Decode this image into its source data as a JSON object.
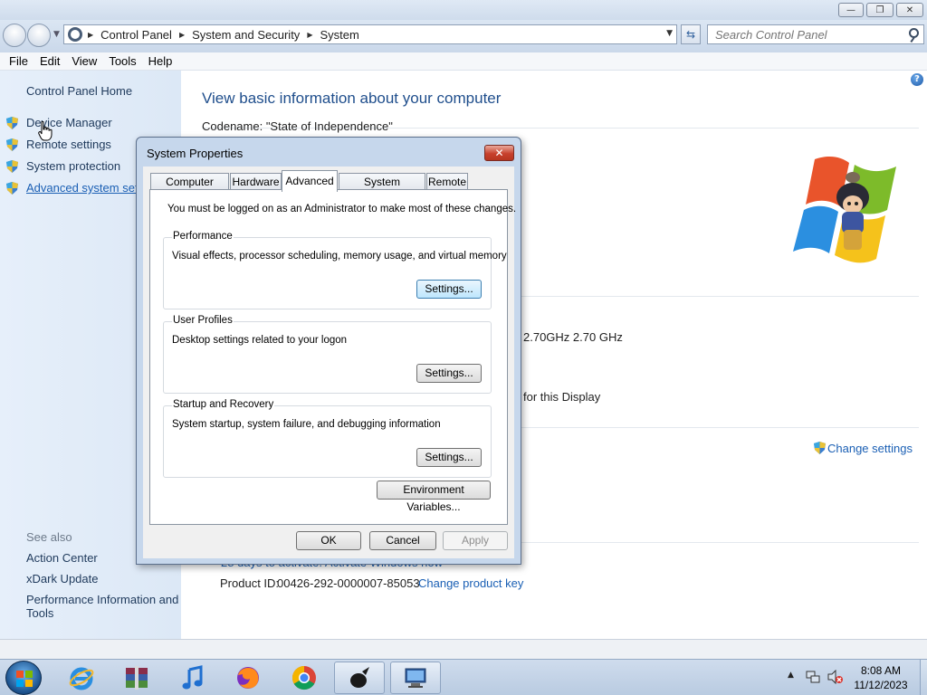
{
  "window": {
    "controls": {
      "minimize": "—",
      "maximize": "❐",
      "close": "✕"
    }
  },
  "address": {
    "crumbs": [
      "Control Panel",
      "System and Security",
      "System"
    ],
    "refresh_glyph": "⇆"
  },
  "search": {
    "placeholder": "Search Control Panel"
  },
  "menu": [
    "File",
    "Edit",
    "View",
    "Tools",
    "Help"
  ],
  "sidebar": {
    "home": "Control Panel Home",
    "tasks": [
      "Device Manager",
      "Remote settings",
      "System protection",
      "Advanced system settings"
    ],
    "see_also_label": "See also",
    "see_also": [
      "Action Center",
      "xDark Update",
      "Performance Information and",
      "Tools"
    ]
  },
  "main": {
    "title": "View basic information about your computer",
    "codename": "Codename: \"State of Independence\"",
    "processor_partial": "2.70GHz   2.70 GHz",
    "display_partial": "for this Display",
    "change_settings": "Change settings",
    "activation_partial": "28 days to activate. Activate Windows now",
    "product_id_label": "Product ID:",
    "product_id": "00426-292-0000007-85053",
    "change_key": "Change product key",
    "help": "?"
  },
  "dialog": {
    "title": "System Properties",
    "close": "✕",
    "tabs": [
      "Computer Name",
      "Hardware",
      "Advanced",
      "System Protection",
      "Remote"
    ],
    "active_tab": "Advanced",
    "admin_note": "You must be logged on as an Administrator to make most of these changes.",
    "groups": [
      {
        "label": "Performance",
        "desc": "Visual effects, processor scheduling, memory usage, and virtual memory",
        "button": "Settings..."
      },
      {
        "label": "User Profiles",
        "desc": "Desktop settings related to your logon",
        "button": "Settings..."
      },
      {
        "label": "Startup and Recovery",
        "desc": "System startup, system failure, and debugging information",
        "button": "Settings..."
      }
    ],
    "env_button": "Environment Variables...",
    "ok": "OK",
    "cancel": "Cancel",
    "apply": "Apply"
  },
  "taskbar": {
    "apps": [
      "internet-explorer",
      "archive-manager",
      "itunes",
      "firefox",
      "chrome",
      "xdark-app",
      "system-properties"
    ],
    "clock": {
      "time": "8:08 AM",
      "date": "11/12/2023"
    }
  },
  "colors": {
    "accent_link": "#1a5fb4",
    "title_blue": "#1f4e8c",
    "sidebar_bg": "#dce8f6"
  }
}
